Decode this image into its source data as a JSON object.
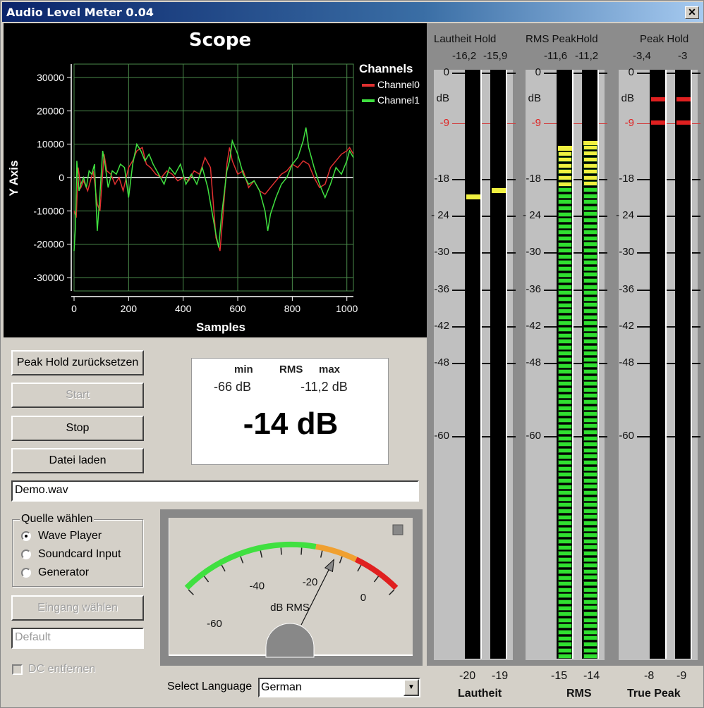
{
  "window": {
    "title": "Audio Level Meter 0.04",
    "close_label": "✕"
  },
  "chart_data": {
    "type": "line",
    "title": "Scope",
    "xlabel": "Samples",
    "ylabel": "Y Axis",
    "xlim": [
      0,
      1024
    ],
    "ylim": [
      -34000,
      34000
    ],
    "xticks": [
      0,
      200,
      400,
      600,
      800,
      1000
    ],
    "yticks": [
      30000,
      20000,
      10000,
      0,
      -10000,
      -20000,
      -30000
    ],
    "ytick_labels": [
      "30000",
      "20000",
      "10000",
      "0",
      "-10000",
      "-20000",
      "-30000"
    ],
    "grid": true,
    "legend_title": "Channels",
    "legend_position": "right",
    "series": [
      {
        "name": "Channel0",
        "color": "#e03030",
        "x": [
          0,
          8,
          15,
          25,
          35,
          50,
          70,
          85,
          95,
          110,
          120,
          135,
          150,
          165,
          180,
          200,
          215,
          230,
          250,
          265,
          280,
          300,
          320,
          340,
          360,
          380,
          400,
          420,
          440,
          460,
          480,
          500,
          520,
          535,
          545,
          560,
          570,
          580,
          600,
          620,
          640,
          660,
          680,
          700,
          720,
          740,
          760,
          780,
          800,
          820,
          840,
          860,
          880,
          900,
          920,
          940,
          960,
          980,
          1000,
          1010,
          1024
        ],
        "y": [
          -10000,
          -12000,
          3000,
          -3000,
          -1000,
          -4000,
          2000,
          -8000,
          -10000,
          7000,
          2000,
          1000,
          -2000,
          0,
          -4000,
          3000,
          5000,
          8000,
          9000,
          4000,
          3000,
          1000,
          0,
          2000,
          1000,
          -1000,
          0,
          -1000,
          2000,
          1000,
          6000,
          3000,
          -18000,
          -22000,
          -12000,
          4000,
          9000,
          5000,
          1000,
          2000,
          -3000,
          -1000,
          -4000,
          -5000,
          -3000,
          -1000,
          1000,
          2000,
          4000,
          3000,
          5000,
          4000,
          0,
          -3000,
          -2000,
          3000,
          5000,
          7000,
          8000,
          9000,
          7000
        ]
      },
      {
        "name": "Channel1",
        "color": "#40e040",
        "x": [
          0,
          5,
          10,
          18,
          25,
          35,
          45,
          55,
          65,
          75,
          85,
          95,
          105,
          115,
          125,
          140,
          155,
          170,
          185,
          200,
          215,
          230,
          245,
          260,
          275,
          290,
          310,
          330,
          350,
          370,
          390,
          410,
          430,
          450,
          470,
          490,
          505,
          520,
          530,
          540,
          550,
          560,
          570,
          580,
          600,
          620,
          640,
          660,
          680,
          700,
          710,
          720,
          740,
          760,
          780,
          800,
          820,
          840,
          850,
          860,
          880,
          900,
          920,
          940,
          960,
          980,
          1000,
          1010,
          1024
        ],
        "y": [
          -22000,
          -15000,
          5000,
          -4000,
          -2000,
          0,
          -3000,
          2000,
          1000,
          4000,
          -16000,
          -5000,
          8000,
          3000,
          -3000,
          2000,
          1000,
          4000,
          3000,
          -6000,
          4000,
          10000,
          8000,
          5000,
          7000,
          4000,
          1000,
          -2000,
          3000,
          1000,
          4000,
          -2000,
          1000,
          -2000,
          3000,
          -3000,
          -10000,
          -17000,
          -21000,
          -12000,
          -5000,
          2000,
          5000,
          11000,
          7000,
          1000,
          -2000,
          -1000,
          -4000,
          -10000,
          -16000,
          -11000,
          -6000,
          -2000,
          0,
          4000,
          6000,
          11000,
          15000,
          9000,
          3000,
          -2000,
          -6000,
          -2000,
          3000,
          1000,
          5000,
          8000,
          6000
        ]
      }
    ]
  },
  "buttons": {
    "peak_hold_reset": "Peak Hold zurücksetzen",
    "start": "Start",
    "stop": "Stop",
    "load_file": "Datei laden",
    "select_input": "Eingang wählen"
  },
  "rms_display": {
    "min_label": "min",
    "rms_label": "RMS",
    "max_label": "max",
    "min_value": "-66 dB",
    "max_value": "-11,2 dB",
    "current_value": "-14 dB"
  },
  "file_field": {
    "value": "Demo.wav"
  },
  "source_group": {
    "legend": "Quelle wählen",
    "options": [
      {
        "label": "Wave Player",
        "selected": true
      },
      {
        "label": "Soundcard Input",
        "selected": false
      },
      {
        "label": "Generator",
        "selected": false
      }
    ]
  },
  "input_device_field": {
    "value": "Default"
  },
  "dc_checkbox": {
    "label": "DC entfernen",
    "checked": false
  },
  "vu_meter": {
    "unit_label": "dB RMS",
    "scale_labels": [
      "-60",
      "-40",
      "-20",
      "0"
    ],
    "range": [
      -60,
      6
    ],
    "needle_value_db": -14,
    "zones": [
      {
        "from": -60,
        "to": -20,
        "color": "#40e040"
      },
      {
        "from": -20,
        "to": -8,
        "color": "#f0a030"
      },
      {
        "from": -8,
        "to": 6,
        "color": "#e02020"
      }
    ]
  },
  "language": {
    "label": "Select Language",
    "selected": "German"
  },
  "level_meters": {
    "scale": [
      "0",
      "dB",
      "-9",
      "-18",
      "- 24",
      "-30",
      "-36",
      "-42",
      "-48",
      "-60"
    ],
    "groups": [
      {
        "hold_title": "Lautheit Hold",
        "hold_values": [
          "-16,2",
          "-15,9"
        ],
        "current_values": [
          "-20",
          "-19"
        ],
        "name": "Lautheit",
        "hold_db": [
          -20.5,
          -19.5
        ],
        "level_db": [
          null,
          null
        ],
        "peak_marks_db": []
      },
      {
        "hold_title": "RMS PeakHold",
        "hold_values": [
          "-11,6",
          "-11,2"
        ],
        "current_values": [
          "-15",
          "-14"
        ],
        "name": "RMS",
        "hold_db": [
          -12.6,
          -11.8
        ],
        "level_db": [
          -15,
          -14
        ],
        "peak_marks_db": []
      },
      {
        "hold_title": "Peak Hold",
        "hold_values": [
          "-3,4",
          "-3"
        ],
        "current_values": [
          "-8",
          "-9"
        ],
        "name": "True Peak",
        "hold_db": [
          -3.4,
          -3
        ],
        "level_db": [
          null,
          null
        ],
        "peak_marks_db": [
          -3.4,
          -9
        ]
      }
    ]
  }
}
